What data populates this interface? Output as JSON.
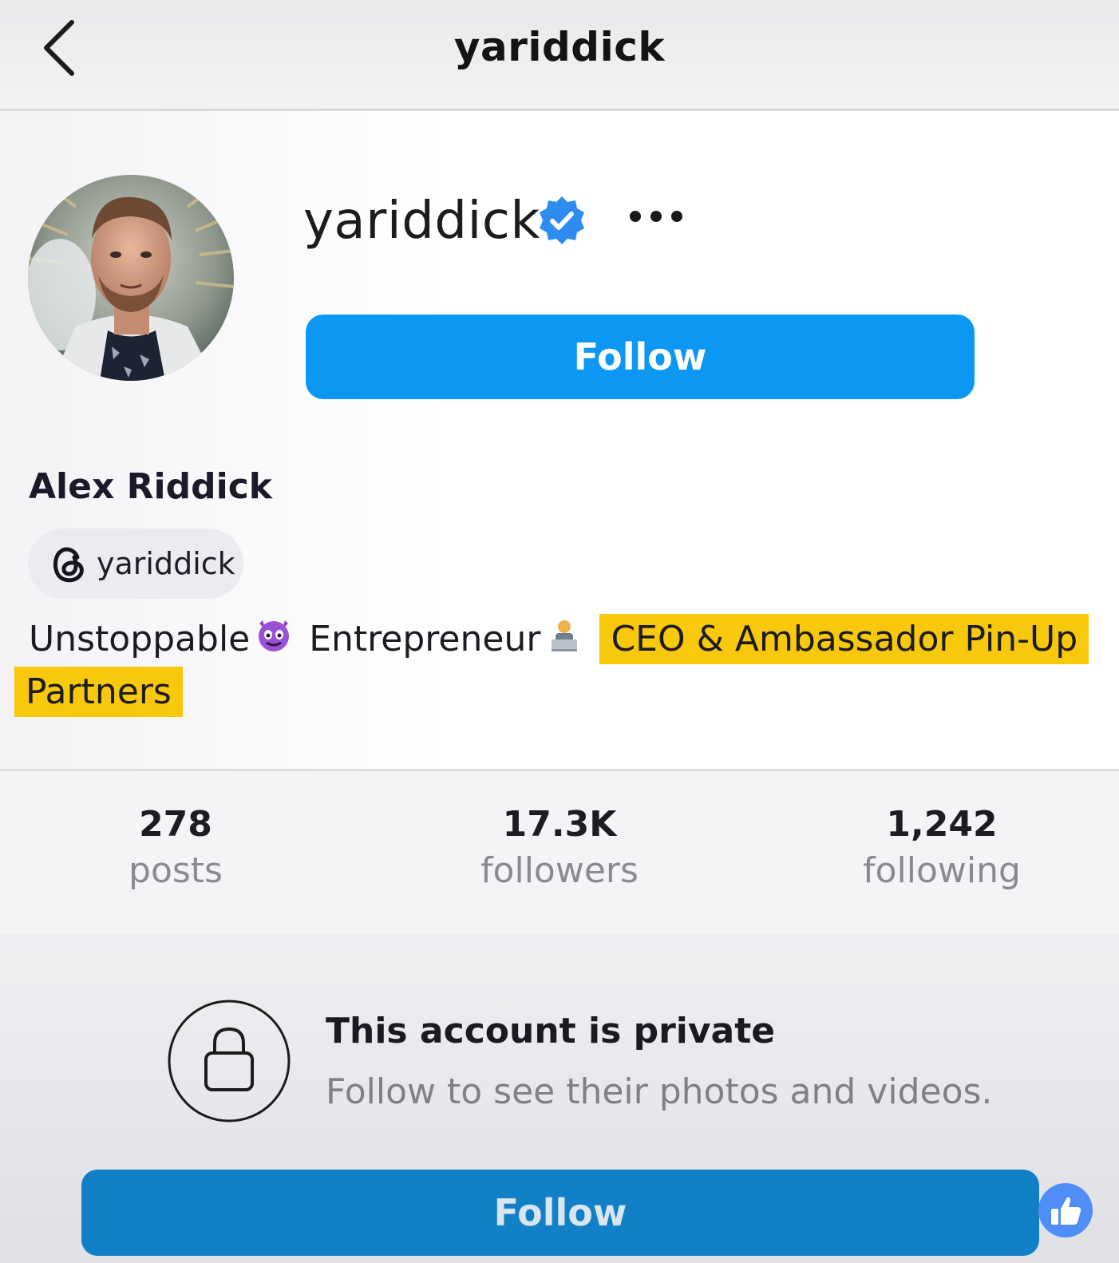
{
  "header": {
    "title": "yariddick"
  },
  "profile": {
    "username": "yariddick",
    "follow_label": "Follow",
    "full_name": "Alex Riddick",
    "threads_handle": "yariddick",
    "bio": {
      "part1": "Unstoppable",
      "part2": "Entrepreneur",
      "highlight1": "CEO & Ambassador Pin-Up",
      "highlight2": "Partners"
    }
  },
  "stats": [
    {
      "value": "278",
      "label": "posts"
    },
    {
      "value": "17.3K",
      "label": "followers"
    },
    {
      "value": "1,242",
      "label": "following"
    }
  ],
  "private_notice": {
    "title": "This account is private",
    "subtitle": "Follow to see their photos and videos.",
    "follow_label": "Follow"
  },
  "icons": {
    "back": "chevron-left-icon",
    "verified": "verified-badge-icon",
    "more": "more-horizontal-icon",
    "threads": "threads-icon",
    "emoji1": "smiling-devil-emoji",
    "emoji2": "technologist-emoji",
    "lock": "lock-icon",
    "like": "thumbs-up-icon"
  },
  "colors": {
    "follow_button": "#0c97f2",
    "highlight": "#f8c80c",
    "verified": "#2d8cf0"
  }
}
